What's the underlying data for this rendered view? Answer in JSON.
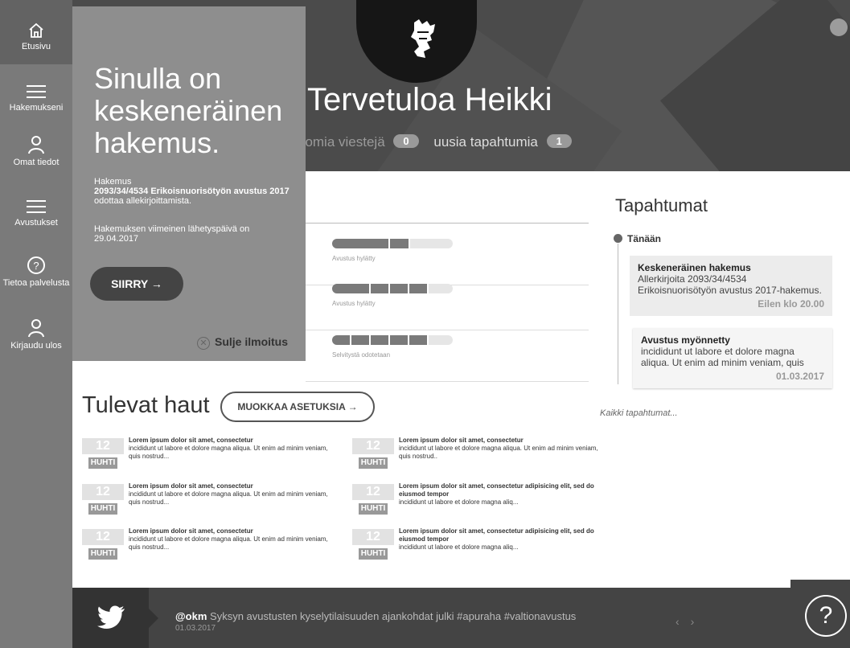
{
  "sidebar": {
    "items": [
      {
        "label": "Etusivu",
        "icon": "home-icon"
      },
      {
        "label": "Hakemukseni",
        "icon": "menu-lines-icon"
      },
      {
        "label": "Omat tiedot",
        "icon": "user-icon"
      },
      {
        "label": "Avustukset",
        "icon": "menu-lines-icon"
      },
      {
        "label": "Tietoa palvelusta",
        "icon": "question-icon"
      },
      {
        "label": "Kirjaudu ulos",
        "icon": "user-icon"
      }
    ]
  },
  "header": {
    "welcome": "Tervetuloa Heikki",
    "messages_label": "ttomia viestejä",
    "messages_count": "0",
    "events_label": "uusia tapahtumia",
    "events_count": "1"
  },
  "notice": {
    "title": "Sinulla on keskeneräinen hakemus.",
    "prefix": "Hakemus",
    "application_id": "2093/34/4534 Erikoisnuorisötyön avustus 2017",
    "status_text": "odottaa allekirjoittamista.",
    "deadline_text": "Hakemuksen viimeinen lähetyspäivä on 29.04.2017",
    "go_button": "SIIRRY →",
    "close_label": "Sulje ilmoitus"
  },
  "applications": [
    {
      "status": "Avustus hylätty",
      "progress": 0.65
    },
    {
      "status": "Avustus hylätty",
      "progress": 0.8
    },
    {
      "status": "Selvitystä odotetaan",
      "progress": 0.8
    }
  ],
  "events": {
    "title": "Tapahtumat",
    "today_label": "Tänään",
    "items": [
      {
        "title": "Keskeneräinen hakemus",
        "text": "Allerkirjoita  2093/34/4534 Erikoisnuorisötyön avustus 2017-hakemus.",
        "date": "Eilen klo 20.00"
      },
      {
        "title": "Avustus myönnetty",
        "text": "incididunt ut labore et dolore magna aliqua. Ut enim ad minim veniam, quis",
        "date": "01.03.2017"
      }
    ],
    "all_link": "Kaikki tapahtumat..."
  },
  "upcoming": {
    "title": "Tulevat haut",
    "edit_button": "MUOKKAA ASETUKSIA →",
    "items": [
      {
        "day": "12",
        "month": "HUHTI",
        "title": "Lorem ipsum dolor sit amet, consectetur",
        "text": "incididunt ut labore et dolore magna aliqua. Ut enim ad minim veniam, quis nostrud..."
      },
      {
        "day": "12",
        "month": "HUHTI",
        "title": "Lorem ipsum dolor sit amet, consectetur",
        "text": "incididunt ut labore et dolore magna aliqua. Ut enim ad minim veniam, quis nostrud.."
      },
      {
        "day": "12",
        "month": "HUHTI",
        "title": "Lorem ipsum dolor sit amet, consectetur",
        "text": "incididunt ut labore et dolore magna aliqua. Ut enim ad minim veniam, quis nostrud..."
      },
      {
        "day": "12",
        "month": "HUHTI",
        "title": "Lorem ipsum dolor sit amet, consectetur adipisicing elit, sed do eiusmod tempor",
        "text": "incididunt ut labore et dolore magna aliq..."
      },
      {
        "day": "12",
        "month": "HUHTI",
        "title": "Lorem ipsum dolor sit amet, consectetur",
        "text": "incididunt ut labore et dolore magna aliqua. Ut enim ad minim veniam, quis nostrud..."
      },
      {
        "day": "12",
        "month": "HUHTI",
        "title": "Lorem ipsum dolor sit amet, consectetur adipisicing elit, sed do eiusmod tempor",
        "text": "incididunt ut labore et dolore magna aliq..."
      }
    ]
  },
  "footer": {
    "handle": "@okm",
    "tweet": "Syksyn avustusten kyselytilaisuuden ajankohdat julki #apuraha #valtionavustus",
    "date": "01.03.2017",
    "prev": "‹",
    "next": "›",
    "help": "?"
  }
}
